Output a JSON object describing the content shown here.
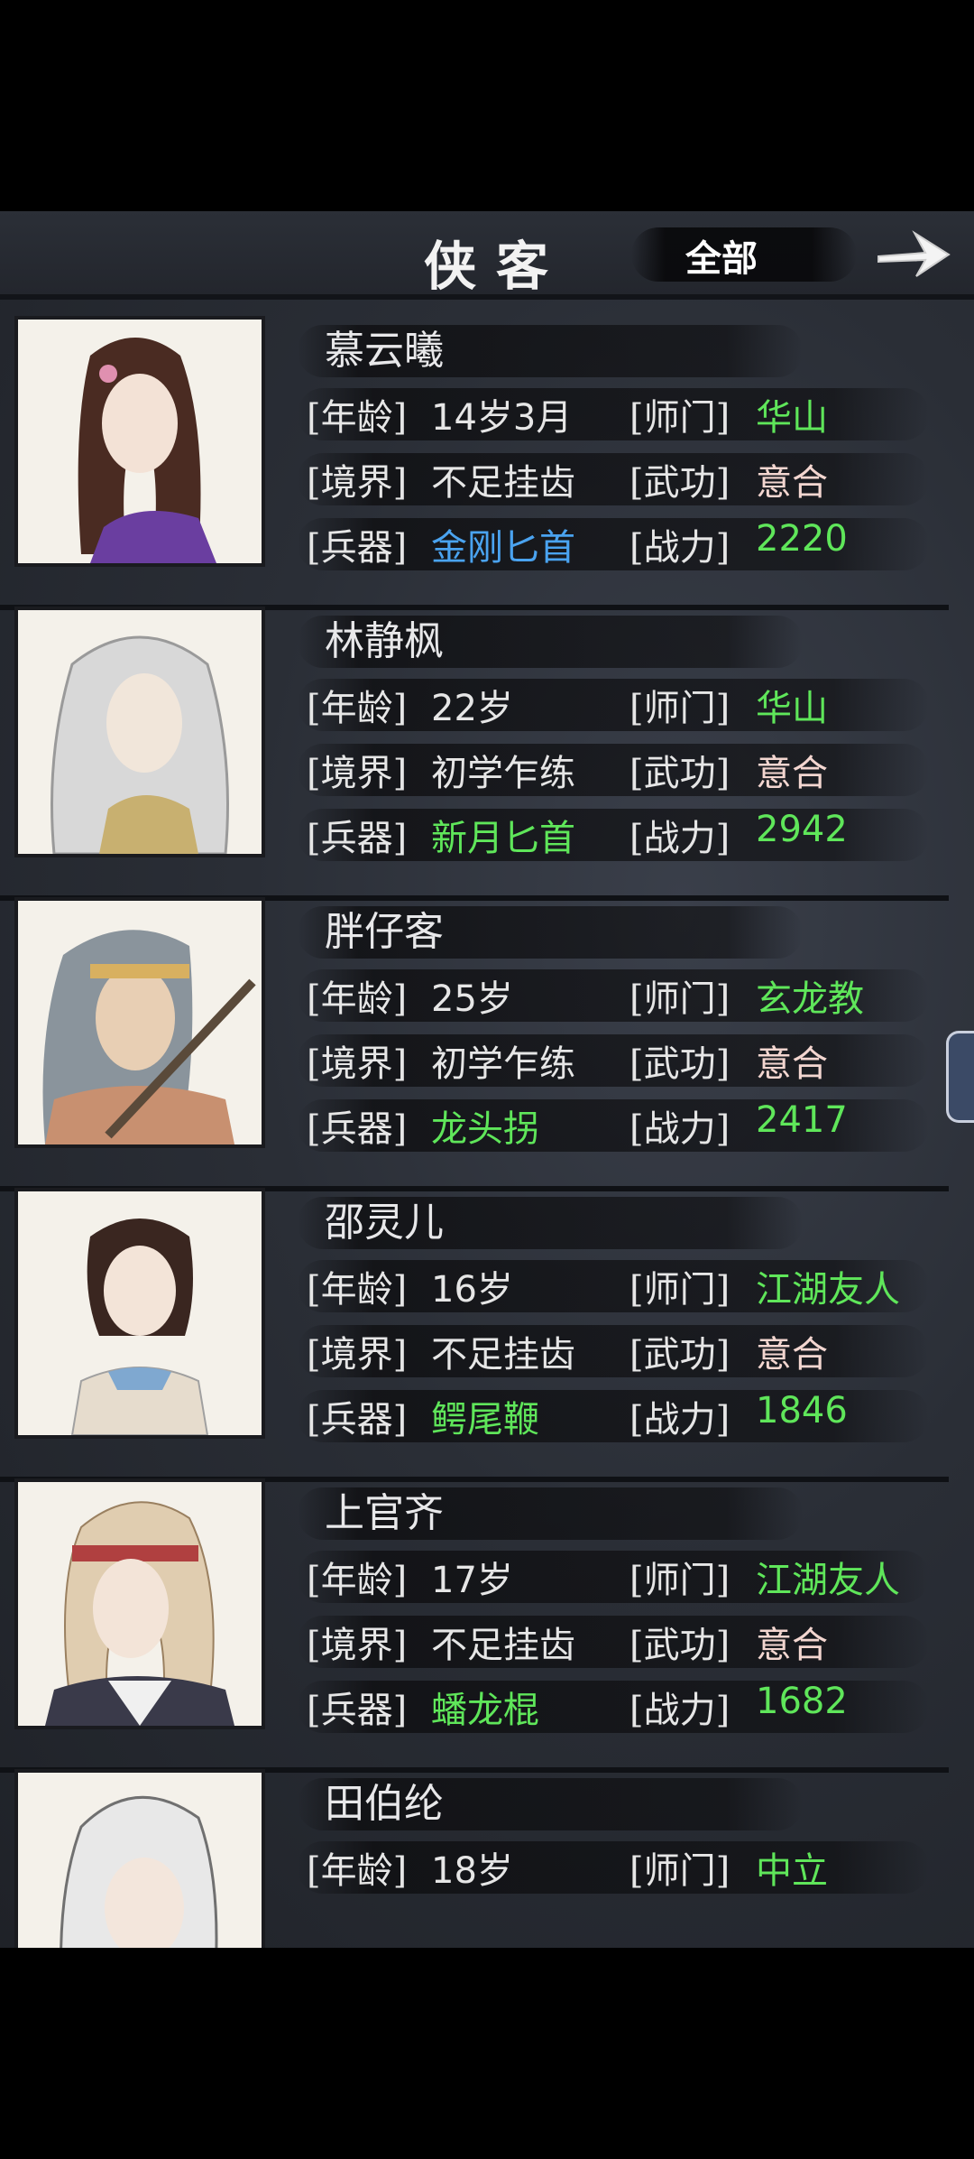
{
  "header": {
    "title": "侠客",
    "filter_label": "全部"
  },
  "labels": {
    "age": "[年龄]",
    "school": "[师门]",
    "realm": "[境界]",
    "martial": "[武功]",
    "weapon": "[兵器]",
    "power": "[战力]"
  },
  "characters": [
    {
      "name": "慕云曦",
      "age": "14岁3月",
      "school": "华山",
      "realm": "不足挂齿",
      "martial": "意合",
      "weapon": "金刚匕首",
      "power": "2220",
      "weapon_color": "#4aa3f0"
    },
    {
      "name": "林静枫",
      "age": "22岁",
      "school": "华山",
      "realm": "初学乍练",
      "martial": "意合",
      "weapon": "新月匕首",
      "power": "2942",
      "weapon_color": "#5fe65a"
    },
    {
      "name": "胖仔客",
      "age": "25岁",
      "school": "玄龙教",
      "realm": "初学乍练",
      "martial": "意合",
      "weapon": "龙头拐",
      "power": "2417",
      "weapon_color": "#5fe65a"
    },
    {
      "name": "邵灵儿",
      "age": "16岁",
      "school": "江湖友人",
      "realm": "不足挂齿",
      "martial": "意合",
      "weapon": "鳄尾鞭",
      "power": "1846",
      "weapon_color": "#5fe65a"
    },
    {
      "name": "上官齐",
      "age": "17岁",
      "school": "江湖友人",
      "realm": "不足挂齿",
      "martial": "意合",
      "weapon": "蟠龙棍",
      "power": "1682",
      "weapon_color": "#5fe65a"
    },
    {
      "name": "田伯纶",
      "age": "18岁",
      "school": "中立"
    }
  ],
  "colors": {
    "green": "#5fe65a",
    "blue": "#4aa3f0",
    "panel": "#2a2e36"
  }
}
